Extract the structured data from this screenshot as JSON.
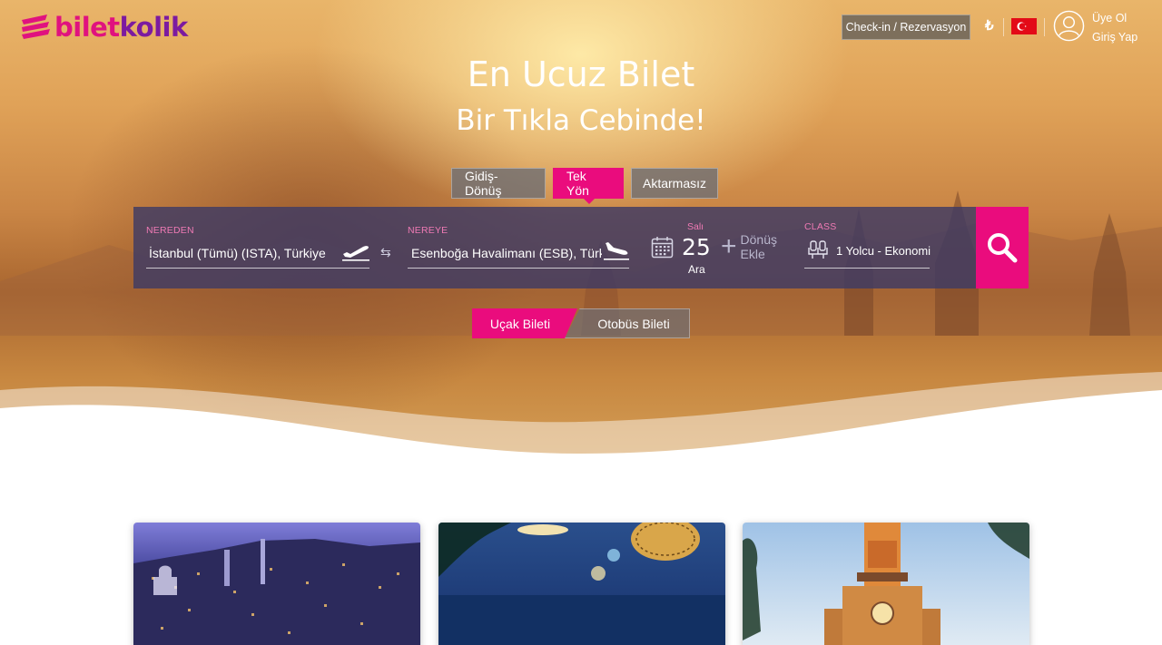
{
  "brand": {
    "name_part1": "bilet",
    "name_part2": "kolik",
    "colors": {
      "pink": "#e0127f",
      "purple": "#7c1aa0",
      "accent": "#ea0c7d"
    }
  },
  "header": {
    "checkin_label": "Check-in / Rezervasyon",
    "currency_symbol": "₺",
    "language_flag": "turkey-flag-icon",
    "signup_label": "Üye Ol",
    "login_label": "Giriş Yap"
  },
  "hero": {
    "title": "En Ucuz Bilet",
    "subtitle": "Bir Tıkla Cebinde!"
  },
  "trip_types": [
    {
      "label": "Gidiş-Dönüş",
      "active": false
    },
    {
      "label": "Tek Yön",
      "active": true
    },
    {
      "label": "Aktarmasız",
      "active": false
    }
  ],
  "search": {
    "from_label": "NEREDEN",
    "from_value": "İstanbul (Tümü) (ISTA), Türkiye",
    "to_label": "NEREYE",
    "to_value": "Esenboğa Havalimanı (ESB), Türkiye",
    "date_day_name": "Salı",
    "date_day": "25",
    "date_month": "Ara",
    "return_label_1": "Dönüş",
    "return_label_2": "Ekle",
    "class_label": "CLASS",
    "class_value": "1 Yolcu - Ekonomi"
  },
  "transport_tabs": [
    {
      "label": "Uçak Bileti",
      "active": true
    },
    {
      "label": "Otobüs Bileti",
      "active": false
    }
  ]
}
